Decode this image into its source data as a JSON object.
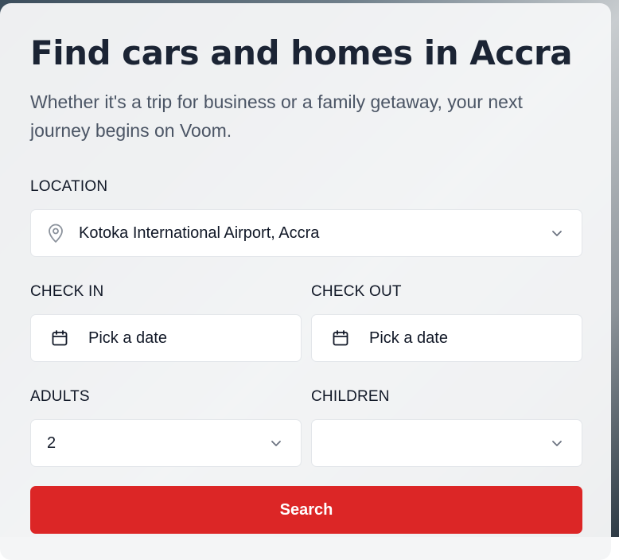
{
  "hero": {
    "title": "Find cars and homes in Accra",
    "subtitle": "Whether it's a trip for business or a family getaway, your next journey begins on Voom."
  },
  "form": {
    "location": {
      "label": "LOCATION",
      "value": "Kotoka International Airport, Accra",
      "icon": "map-pin-icon"
    },
    "check_in": {
      "label": "CHECK IN",
      "placeholder": "Pick a date",
      "icon": "calendar-icon"
    },
    "check_out": {
      "label": "CHECK OUT",
      "placeholder": "Pick a date",
      "icon": "calendar-icon"
    },
    "adults": {
      "label": "ADULTS",
      "value": "2"
    },
    "children": {
      "label": "CHILDREN",
      "value": ""
    },
    "search_label": "Search"
  },
  "colors": {
    "accent": "#dc2626",
    "title": "#1b2434",
    "subtitle": "#4b5565"
  }
}
